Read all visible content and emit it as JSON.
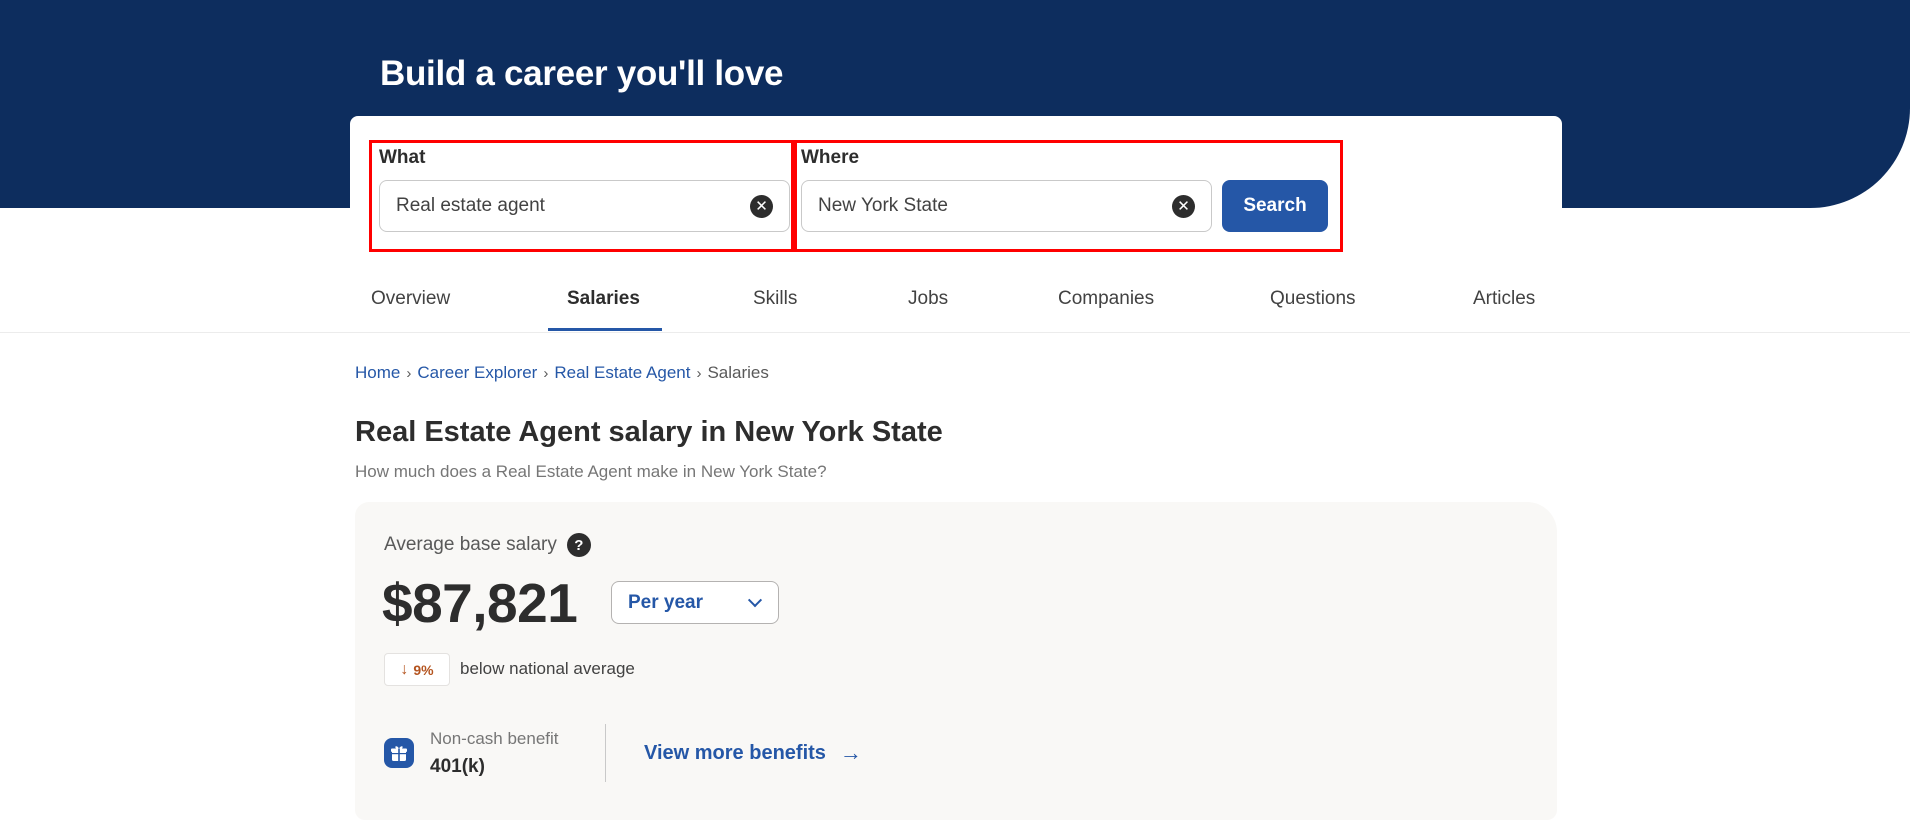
{
  "hero": {
    "headline": "Build a career you'll love"
  },
  "search": {
    "what_label": "What",
    "what_value": "Real estate agent",
    "where_label": "Where",
    "where_value": "New York State",
    "clear_glyph": "✕",
    "search_button": "Search"
  },
  "tabs": [
    {
      "label": "Overview",
      "active": false
    },
    {
      "label": "Salaries",
      "active": true
    },
    {
      "label": "Skills",
      "active": false
    },
    {
      "label": "Jobs",
      "active": false
    },
    {
      "label": "Companies",
      "active": false
    },
    {
      "label": "Questions",
      "active": false
    },
    {
      "label": "Articles",
      "active": false
    }
  ],
  "breadcrumb": {
    "items": [
      "Home",
      "Career Explorer",
      "Real Estate Agent"
    ],
    "current": "Salaries",
    "separator": "›"
  },
  "page": {
    "title": "Real Estate Agent salary in New York State",
    "subtitle": "How much does a Real Estate Agent make in New York State?"
  },
  "salary": {
    "label": "Average base salary",
    "help_glyph": "?",
    "value": "$87,821",
    "period": "Per year",
    "diff_arrow": "↓",
    "diff_percent": "9%",
    "diff_text": "below national average"
  },
  "benefits": {
    "label": "Non-cash benefit",
    "value": "401(k)",
    "view_more": "View more benefits",
    "arrow": "→"
  },
  "colors": {
    "navy": "#0d2d5e",
    "primary": "#2557a7",
    "highlight": "#ff0000",
    "diff_orange": "#b4541f",
    "card_bg": "#f9f8f6"
  }
}
